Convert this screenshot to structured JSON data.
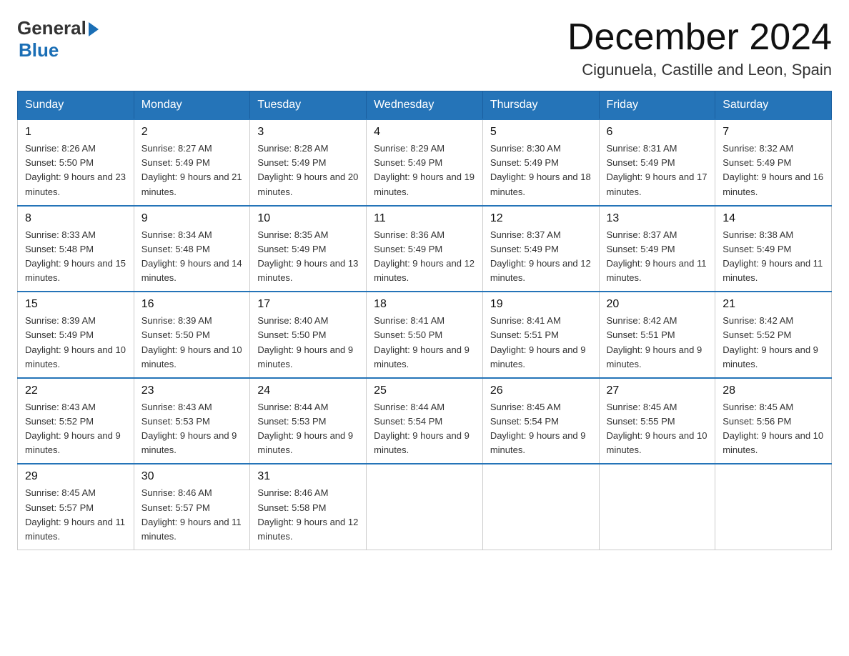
{
  "header": {
    "logo_general": "General",
    "logo_blue": "Blue",
    "month_title": "December 2024",
    "location": "Cigunuela, Castille and Leon, Spain"
  },
  "weekdays": [
    "Sunday",
    "Monday",
    "Tuesday",
    "Wednesday",
    "Thursday",
    "Friday",
    "Saturday"
  ],
  "weeks": [
    [
      {
        "day": "1",
        "sunrise": "Sunrise: 8:26 AM",
        "sunset": "Sunset: 5:50 PM",
        "daylight": "Daylight: 9 hours and 23 minutes."
      },
      {
        "day": "2",
        "sunrise": "Sunrise: 8:27 AM",
        "sunset": "Sunset: 5:49 PM",
        "daylight": "Daylight: 9 hours and 21 minutes."
      },
      {
        "day": "3",
        "sunrise": "Sunrise: 8:28 AM",
        "sunset": "Sunset: 5:49 PM",
        "daylight": "Daylight: 9 hours and 20 minutes."
      },
      {
        "day": "4",
        "sunrise": "Sunrise: 8:29 AM",
        "sunset": "Sunset: 5:49 PM",
        "daylight": "Daylight: 9 hours and 19 minutes."
      },
      {
        "day": "5",
        "sunrise": "Sunrise: 8:30 AM",
        "sunset": "Sunset: 5:49 PM",
        "daylight": "Daylight: 9 hours and 18 minutes."
      },
      {
        "day": "6",
        "sunrise": "Sunrise: 8:31 AM",
        "sunset": "Sunset: 5:49 PM",
        "daylight": "Daylight: 9 hours and 17 minutes."
      },
      {
        "day": "7",
        "sunrise": "Sunrise: 8:32 AM",
        "sunset": "Sunset: 5:49 PM",
        "daylight": "Daylight: 9 hours and 16 minutes."
      }
    ],
    [
      {
        "day": "8",
        "sunrise": "Sunrise: 8:33 AM",
        "sunset": "Sunset: 5:48 PM",
        "daylight": "Daylight: 9 hours and 15 minutes."
      },
      {
        "day": "9",
        "sunrise": "Sunrise: 8:34 AM",
        "sunset": "Sunset: 5:48 PM",
        "daylight": "Daylight: 9 hours and 14 minutes."
      },
      {
        "day": "10",
        "sunrise": "Sunrise: 8:35 AM",
        "sunset": "Sunset: 5:49 PM",
        "daylight": "Daylight: 9 hours and 13 minutes."
      },
      {
        "day": "11",
        "sunrise": "Sunrise: 8:36 AM",
        "sunset": "Sunset: 5:49 PM",
        "daylight": "Daylight: 9 hours and 12 minutes."
      },
      {
        "day": "12",
        "sunrise": "Sunrise: 8:37 AM",
        "sunset": "Sunset: 5:49 PM",
        "daylight": "Daylight: 9 hours and 12 minutes."
      },
      {
        "day": "13",
        "sunrise": "Sunrise: 8:37 AM",
        "sunset": "Sunset: 5:49 PM",
        "daylight": "Daylight: 9 hours and 11 minutes."
      },
      {
        "day": "14",
        "sunrise": "Sunrise: 8:38 AM",
        "sunset": "Sunset: 5:49 PM",
        "daylight": "Daylight: 9 hours and 11 minutes."
      }
    ],
    [
      {
        "day": "15",
        "sunrise": "Sunrise: 8:39 AM",
        "sunset": "Sunset: 5:49 PM",
        "daylight": "Daylight: 9 hours and 10 minutes."
      },
      {
        "day": "16",
        "sunrise": "Sunrise: 8:39 AM",
        "sunset": "Sunset: 5:50 PM",
        "daylight": "Daylight: 9 hours and 10 minutes."
      },
      {
        "day": "17",
        "sunrise": "Sunrise: 8:40 AM",
        "sunset": "Sunset: 5:50 PM",
        "daylight": "Daylight: 9 hours and 9 minutes."
      },
      {
        "day": "18",
        "sunrise": "Sunrise: 8:41 AM",
        "sunset": "Sunset: 5:50 PM",
        "daylight": "Daylight: 9 hours and 9 minutes."
      },
      {
        "day": "19",
        "sunrise": "Sunrise: 8:41 AM",
        "sunset": "Sunset: 5:51 PM",
        "daylight": "Daylight: 9 hours and 9 minutes."
      },
      {
        "day": "20",
        "sunrise": "Sunrise: 8:42 AM",
        "sunset": "Sunset: 5:51 PM",
        "daylight": "Daylight: 9 hours and 9 minutes."
      },
      {
        "day": "21",
        "sunrise": "Sunrise: 8:42 AM",
        "sunset": "Sunset: 5:52 PM",
        "daylight": "Daylight: 9 hours and 9 minutes."
      }
    ],
    [
      {
        "day": "22",
        "sunrise": "Sunrise: 8:43 AM",
        "sunset": "Sunset: 5:52 PM",
        "daylight": "Daylight: 9 hours and 9 minutes."
      },
      {
        "day": "23",
        "sunrise": "Sunrise: 8:43 AM",
        "sunset": "Sunset: 5:53 PM",
        "daylight": "Daylight: 9 hours and 9 minutes."
      },
      {
        "day": "24",
        "sunrise": "Sunrise: 8:44 AM",
        "sunset": "Sunset: 5:53 PM",
        "daylight": "Daylight: 9 hours and 9 minutes."
      },
      {
        "day": "25",
        "sunrise": "Sunrise: 8:44 AM",
        "sunset": "Sunset: 5:54 PM",
        "daylight": "Daylight: 9 hours and 9 minutes."
      },
      {
        "day": "26",
        "sunrise": "Sunrise: 8:45 AM",
        "sunset": "Sunset: 5:54 PM",
        "daylight": "Daylight: 9 hours and 9 minutes."
      },
      {
        "day": "27",
        "sunrise": "Sunrise: 8:45 AM",
        "sunset": "Sunset: 5:55 PM",
        "daylight": "Daylight: 9 hours and 10 minutes."
      },
      {
        "day": "28",
        "sunrise": "Sunrise: 8:45 AM",
        "sunset": "Sunset: 5:56 PM",
        "daylight": "Daylight: 9 hours and 10 minutes."
      }
    ],
    [
      {
        "day": "29",
        "sunrise": "Sunrise: 8:45 AM",
        "sunset": "Sunset: 5:57 PM",
        "daylight": "Daylight: 9 hours and 11 minutes."
      },
      {
        "day": "30",
        "sunrise": "Sunrise: 8:46 AM",
        "sunset": "Sunset: 5:57 PM",
        "daylight": "Daylight: 9 hours and 11 minutes."
      },
      {
        "day": "31",
        "sunrise": "Sunrise: 8:46 AM",
        "sunset": "Sunset: 5:58 PM",
        "daylight": "Daylight: 9 hours and 12 minutes."
      },
      null,
      null,
      null,
      null
    ]
  ]
}
